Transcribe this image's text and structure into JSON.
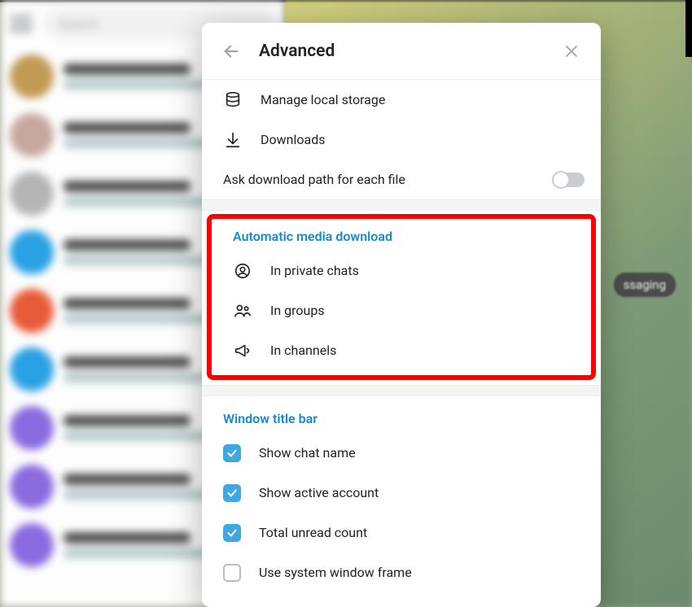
{
  "search": {
    "placeholder": "Search"
  },
  "bg_badge": "ssaging",
  "dialog": {
    "title": "Advanced",
    "storage_label": "Manage local storage",
    "downloads_label": "Downloads",
    "ask_path_label": "Ask download path for each file",
    "ask_path_on": false,
    "auto_section_title": "Automatic media download",
    "auto_private": "In private chats",
    "auto_groups": "In groups",
    "auto_channels": "In channels",
    "title_section_title": "Window title bar",
    "cb_chat_name": "Show chat name",
    "cb_chat_name_on": true,
    "cb_active_account": "Show active account",
    "cb_active_account_on": true,
    "cb_unread": "Total unread count",
    "cb_unread_on": true,
    "cb_system_frame": "Use system window frame",
    "cb_system_frame_on": false
  },
  "chat_avatars": [
    "#c29a54",
    "#c7a89f",
    "#b5b5b5",
    "#2aa0e5",
    "#e85b38",
    "#2aa0e5",
    "#8a6be0",
    "#8a6be0",
    "#8a6be0"
  ]
}
